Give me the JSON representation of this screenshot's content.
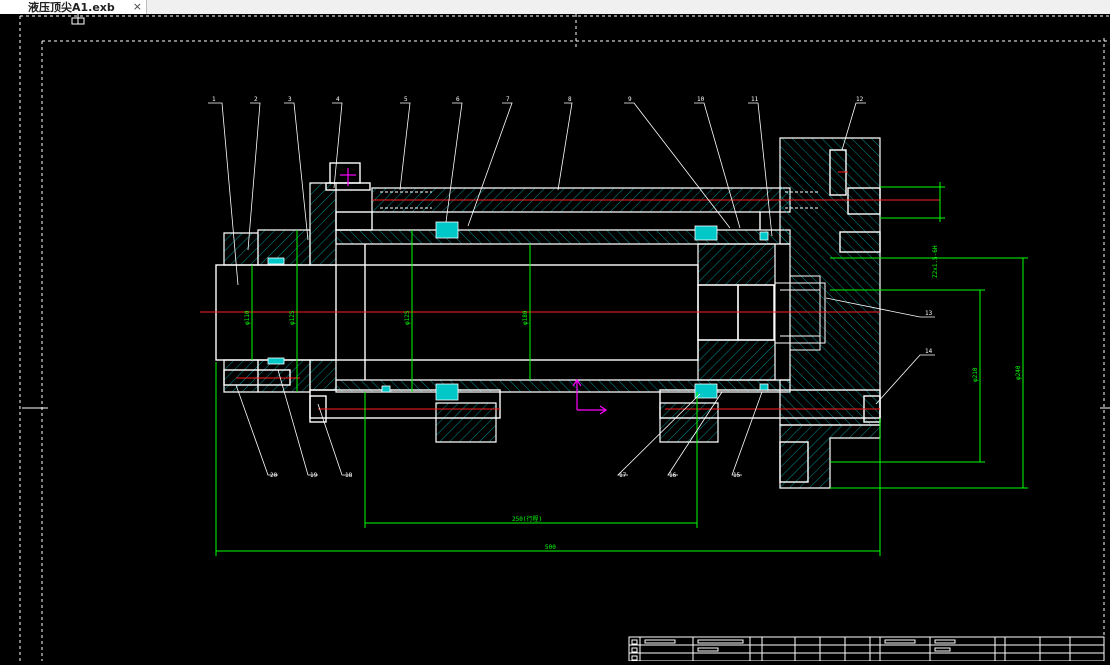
{
  "app": {
    "tab_title": "液压顶尖A1.exb",
    "close_glyph": "×"
  },
  "drawing": {
    "balloons": [
      "1",
      "2",
      "3",
      "4",
      "5",
      "6",
      "7",
      "8",
      "9",
      "10",
      "11",
      "12",
      "13",
      "14",
      "15",
      "16",
      "17",
      "18",
      "19",
      "20"
    ],
    "dims": {
      "overall_length": "500",
      "stroke": "250(行程)",
      "d_left1": "φ110",
      "d_left2": "φ125",
      "d_mid1": "φ125",
      "d_mid2": "φ180",
      "d_right1": "Z2x1.5-6H",
      "d_right2": "φ210",
      "d_right3": "φ240"
    },
    "colors": {
      "outline": "#ffffff",
      "hatch": "#00bcbc",
      "dim": "#00ff00",
      "center": "#ff2020",
      "leader": "#ffffff",
      "border": "#ffffff",
      "ucs": "#ff00ff",
      "seal": "#00c8c8"
    }
  }
}
